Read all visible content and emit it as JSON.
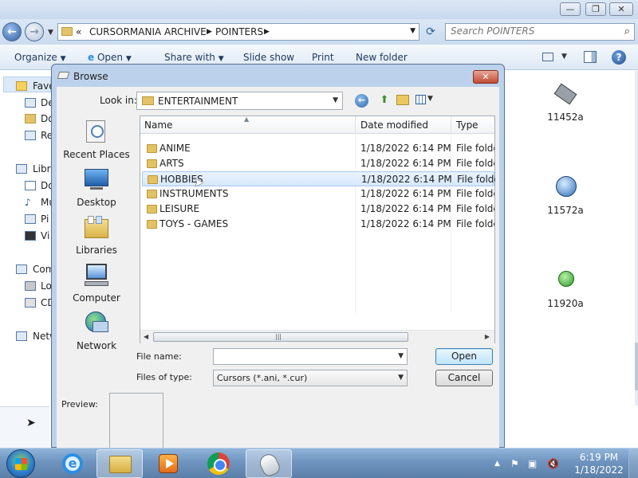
{
  "explorer": {
    "window_controls": {
      "minimize": "—",
      "maximize": "❐",
      "close": "✕"
    },
    "breadcrumb": [
      "«",
      "CURSORMANIA ARCHIVE",
      "POINTERS"
    ],
    "search_placeholder": "Search POINTERS",
    "toolbar": {
      "organize": "Organize",
      "open": "Open",
      "share_with": "Share with",
      "slide_show": "Slide show",
      "print": "Print",
      "new_folder": "New folder"
    },
    "nav_fragments": [
      "Fave",
      "De",
      "Do",
      "Re",
      "Libra",
      "Do",
      "Mu",
      "Pi",
      "Vi",
      "Com",
      "Lo",
      "CD",
      "Netw"
    ],
    "files": [
      {
        "name": "11452a",
        "icon": "cursor-file-icon"
      },
      {
        "name": "11572a",
        "icon": "cursor-file-icon"
      },
      {
        "name": "11920a",
        "icon": "cursor-file-icon"
      }
    ]
  },
  "dialog": {
    "title": "Browse",
    "close": "✕",
    "look_in_label": "Look in:",
    "look_in_value": "ENTERTAINMENT",
    "places": [
      {
        "label": "Recent Places",
        "icon": "recent-places-icon"
      },
      {
        "label": "Desktop",
        "icon": "desktop-icon"
      },
      {
        "label": "Libraries",
        "icon": "libraries-icon"
      },
      {
        "label": "Computer",
        "icon": "computer-icon"
      },
      {
        "label": "Network",
        "icon": "network-icon"
      }
    ],
    "columns": {
      "name": "Name",
      "date": "Date modified",
      "type": "Type"
    },
    "rows": [
      {
        "name": "ANIME",
        "date": "1/18/2022 6:14 PM",
        "type": "File folder"
      },
      {
        "name": "ARTS",
        "date": "1/18/2022 6:14 PM",
        "type": "File folder"
      },
      {
        "name": "HOBBIES",
        "date": "1/18/2022 6:14 PM",
        "type": "File folder"
      },
      {
        "name": "INSTRUMENTS",
        "date": "1/18/2022 6:14 PM",
        "type": "File folder"
      },
      {
        "name": "LEISURE",
        "date": "1/18/2022 6:14 PM",
        "type": "File folder"
      },
      {
        "name": "TOYS - GAMES",
        "date": "1/18/2022 6:14 PM",
        "type": "File folder"
      }
    ],
    "hovered_row": 2,
    "file_name_label": "File name:",
    "file_name_value": "",
    "file_type_label": "Files of type:",
    "file_type_value": "Cursors (*.ani, *.cur)",
    "open_label": "Open",
    "cancel_label": "Cancel",
    "preview_label": "Preview:"
  },
  "taskbar": {
    "apps": [
      "internet-explorer",
      "windows-explorer",
      "media-player",
      "chrome",
      "mouse-properties"
    ],
    "active_app": "mouse-properties",
    "time": "6:19 PM",
    "date": "1/18/2022"
  },
  "colors": {
    "accent": "#3c7fb1",
    "taskbar": "#6f94bf",
    "folder": "#e3c263"
  }
}
